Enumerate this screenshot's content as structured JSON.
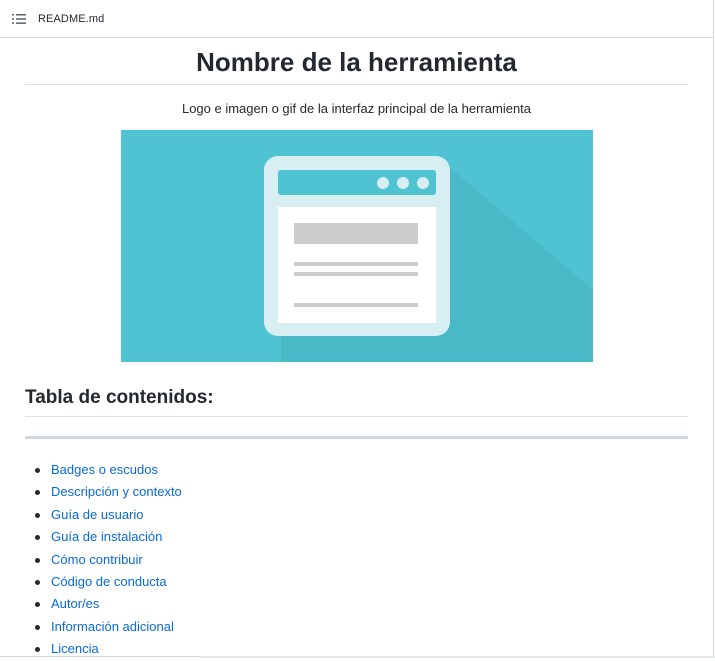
{
  "file": {
    "name": "README.md",
    "toc_icon": "list-unordered-icon"
  },
  "readme": {
    "title": "Nombre de la herramienta",
    "intro": "Logo e imagen o gif de la interfaz principal de la herramienta",
    "hero_image": "browser-window-illustration",
    "toc_heading": "Tabla de contenidos:",
    "toc_items": [
      "Badges o escudos",
      "Descripción y contexto",
      "Guía de usuario",
      "Guía de instalación",
      "Cómo contribuir",
      "Código de conducta",
      "Autor/es",
      "Información adicional",
      "Licencia"
    ]
  },
  "colors": {
    "link": "#0969da",
    "hero_bg": "#4fc3d1",
    "hero_frame": "#d7eef2"
  }
}
